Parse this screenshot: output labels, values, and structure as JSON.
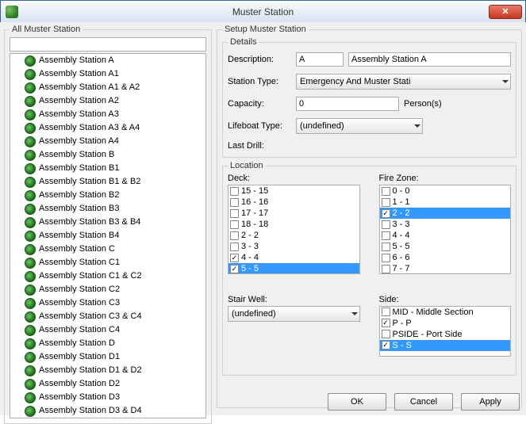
{
  "window": {
    "title": "Muster Station",
    "close_glyph": "✕"
  },
  "left_panel": {
    "legend": "All Muster Station",
    "filter": "",
    "items": [
      "Assembly Station A",
      "Assembly Station A1",
      "Assembly Station A1 & A2",
      "Assembly Station A2",
      "Assembly Station A3",
      "Assembly Station A3 & A4",
      "Assembly Station A4",
      "Assembly Station B",
      "Assembly Station B1",
      "Assembly Station B1 & B2",
      "Assembly Station B2",
      "Assembly Station B3",
      "Assembly Station B3 & B4",
      "Assembly Station B4",
      "Assembly Station C",
      "Assembly Station C1",
      "Assembly Station C1 & C2",
      "Assembly Station C2",
      "Assembly Station C3",
      "Assembly Station C3 & C4",
      "Assembly Station C4",
      "Assembly Station D",
      "Assembly Station D1",
      "Assembly Station D1 & D2",
      "Assembly Station D2",
      "Assembly Station D3",
      "Assembly Station D3 & D4"
    ]
  },
  "setup": {
    "legend": "Setup Muster Station",
    "details": {
      "legend": "Details",
      "labels": {
        "description": "Description:",
        "station_type": "Station Type:",
        "capacity": "Capacity:",
        "lifeboat_type": "Lifeboat Type:",
        "last_drill": "Last Drill:",
        "persons": "Person(s)"
      },
      "values": {
        "description_code": "A",
        "description_name": "Assembly Station A",
        "station_type": "Emergency And Muster Stati",
        "capacity": "0",
        "lifeboat_type": "(undefined)",
        "last_drill": ""
      }
    },
    "location": {
      "legend": "Location",
      "deck_label": "Deck:",
      "firezone_label": "Fire Zone:",
      "stairwell_label": "Stair Well:",
      "side_label": "Side:",
      "stairwell_value": "(undefined)",
      "deck": [
        {
          "label": "15 - 15",
          "checked": false,
          "selected": false
        },
        {
          "label": "16 - 16",
          "checked": false,
          "selected": false
        },
        {
          "label": "17 - 17",
          "checked": false,
          "selected": false
        },
        {
          "label": "18 - 18",
          "checked": false,
          "selected": false
        },
        {
          "label": "2 - 2",
          "checked": false,
          "selected": false
        },
        {
          "label": "3 - 3",
          "checked": false,
          "selected": false
        },
        {
          "label": "4 - 4",
          "checked": true,
          "selected": false
        },
        {
          "label": "5 - 5",
          "checked": true,
          "selected": true
        }
      ],
      "firezone": [
        {
          "label": "0 - 0",
          "checked": false,
          "selected": false
        },
        {
          "label": "1 - 1",
          "checked": false,
          "selected": false
        },
        {
          "label": "2 - 2",
          "checked": true,
          "selected": true
        },
        {
          "label": "3 - 3",
          "checked": false,
          "selected": false
        },
        {
          "label": "4 - 4",
          "checked": false,
          "selected": false
        },
        {
          "label": "5 - 5",
          "checked": false,
          "selected": false
        },
        {
          "label": "6 - 6",
          "checked": false,
          "selected": false
        },
        {
          "label": "7 - 7",
          "checked": false,
          "selected": false
        }
      ],
      "side": [
        {
          "label": "MID - Middle Section",
          "checked": false,
          "selected": false
        },
        {
          "label": "P - P",
          "checked": true,
          "selected": false
        },
        {
          "label": "PSIDE - Port Side",
          "checked": false,
          "selected": false
        },
        {
          "label": "S - S",
          "checked": true,
          "selected": true
        }
      ]
    }
  },
  "buttons": {
    "ok": "OK",
    "cancel": "Cancel",
    "apply": "Apply"
  }
}
